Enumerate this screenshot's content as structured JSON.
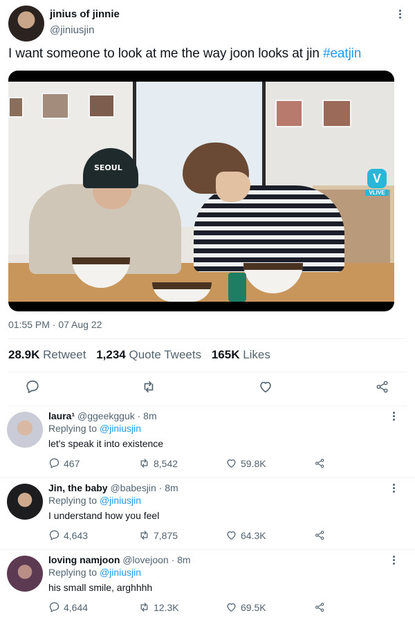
{
  "tweet": {
    "display_name": "jinius of jinnie",
    "handle": "@jiniusjin",
    "text": "I want someone to look at me the way joon looks at jin ",
    "hashtag": "#eatjin",
    "media": {
      "cap_text": "SEOUL",
      "vlive_mark": "V",
      "vlive_label": "VLIVE"
    },
    "timestamp": "01:55 PM · 07 Aug 22",
    "stats": {
      "retweets_count": "28.9K",
      "retweets_label": "Retweet",
      "quotes_count": "1,234",
      "quotes_label": "Quote Tweets",
      "likes_count": "165K",
      "likes_label": "Likes"
    }
  },
  "replies": [
    {
      "name": "laura¹",
      "handle_time": "@ggeekgguk · 8m",
      "replying_prefix": "Replying to ",
      "replying_to": "@jiniusjin",
      "text": "let's speak it into existence",
      "reply_count": "467",
      "retweet_count": "8,542",
      "like_count": "59.8K"
    },
    {
      "name": "Jin, the baby",
      "handle_time": "@babesjin · 8m",
      "replying_prefix": "Replying to ",
      "replying_to": "@jiniusjin",
      "text": "I understand how you feel",
      "reply_count": "4,643",
      "retweet_count": "7,875",
      "like_count": "64.3K"
    },
    {
      "name": "loving namjoon",
      "handle_time": "@lovejoon · 8m",
      "replying_prefix": "Replying to ",
      "replying_to": "@jiniusjin",
      "text": "his small smile, arghhhh",
      "reply_count": "4,644",
      "retweet_count": "12.3K",
      "like_count": "69.5K"
    }
  ],
  "colors": {
    "accent": "#1d9bf0",
    "text_primary": "#0f1419",
    "text_secondary": "#536471",
    "divider": "#eff3f4"
  },
  "icons": [
    "more-icon",
    "reply-icon",
    "retweet-icon",
    "like-icon",
    "share-icon"
  ]
}
